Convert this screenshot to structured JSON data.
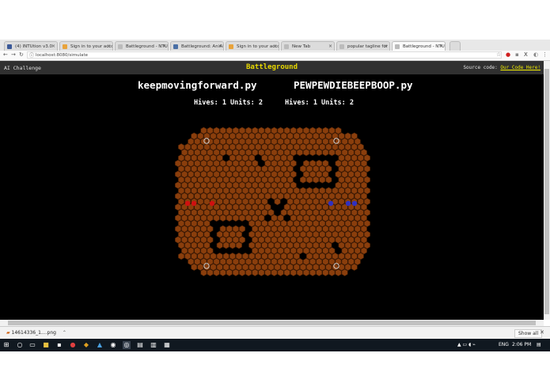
{
  "browser": {
    "tabs": [
      {
        "label": "(4) INTUtion v3.0",
        "color": "#3b5998"
      },
      {
        "label": "Sign in to your acco",
        "color": "#e8a33b"
      },
      {
        "label": "Battleground - NTU",
        "color": "#bbbbbb"
      },
      {
        "label": "Battleground: An AI",
        "color": "#4a6fa5"
      },
      {
        "label": "Sign in to your acco",
        "color": "#e8a33b"
      },
      {
        "label": "New Tab",
        "color": "#bbbbbb"
      },
      {
        "label": "popular tagline for",
        "color": "#bbbbbb"
      },
      {
        "label": "Battleground - NTU",
        "color": "#bbbbbb"
      }
    ],
    "active_tab_index": 7,
    "url": "localhost:8080/simulate",
    "controls": {
      "minimize": "–",
      "maximize": "❐",
      "close": "✕"
    }
  },
  "page": {
    "brand": "AI Challenge",
    "title": "Battleground",
    "source_label": "Source code:",
    "source_link": "Our Code Here!",
    "players": [
      {
        "name": "keepmovingforward.py",
        "stats": "Hives: 1 Units: 2"
      },
      {
        "name": "PEWPEWDIEBEEPBOOP.py",
        "stats": "Hives: 1 Units: 2"
      }
    ],
    "colors": {
      "cell": "#8a3e0c",
      "cell_stroke": "#4a2006",
      "player1": "#d01010",
      "player2": "#3030c0",
      "hive": "#cfcfcf"
    }
  },
  "download": {
    "file": "14614336_1....png",
    "show_all": "Show all"
  },
  "taskbar": {
    "time": "2:06 PM",
    "lang": "ENG"
  }
}
